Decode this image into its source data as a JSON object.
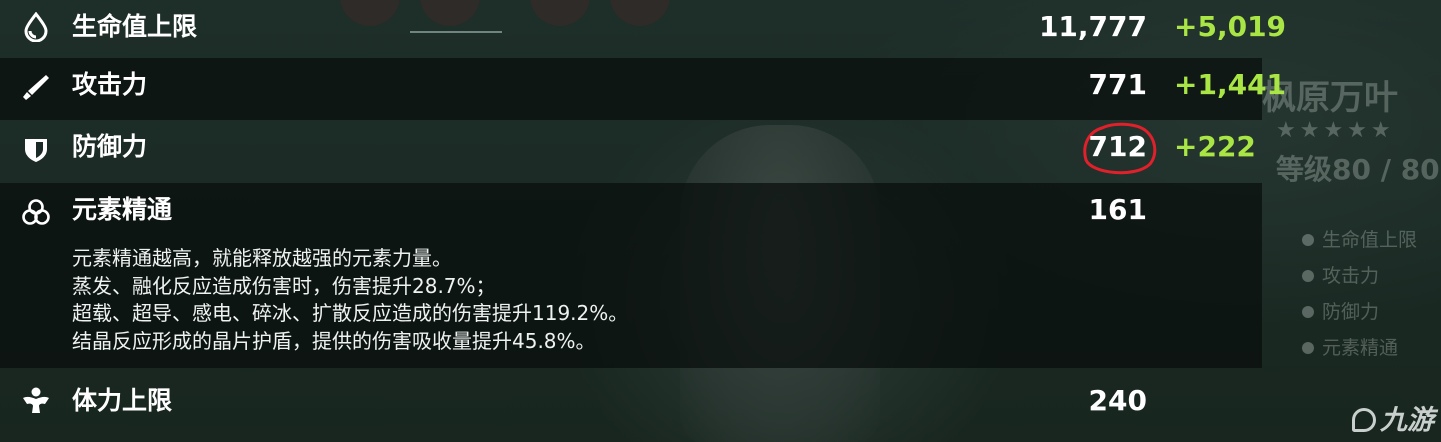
{
  "stats": {
    "hp": {
      "label": "生命值上限",
      "value": "11,777",
      "bonus": "+5,019",
      "icon": "water-drop-icon"
    },
    "atk": {
      "label": "攻击力",
      "value": "771",
      "bonus": "+1,441",
      "icon": "sword-icon"
    },
    "def": {
      "label": "防御力",
      "value": "712",
      "bonus": "+222",
      "icon": "shield-icon"
    },
    "em": {
      "label": "元素精通",
      "value": "161",
      "icon": "elemental-mastery-icon",
      "description": [
        "元素精通越高，就能释放越强的元素力量。",
        "蒸发、融化反应造成伤害时，伤害提升28.7%；",
        "超载、超导、感电、碎冰、扩散反应造成的伤害提升119.2%。",
        "结晶反应形成的晶片护盾，提供的伤害吸收量提升45.8%。"
      ]
    },
    "stamina": {
      "label": "体力上限",
      "value": "240",
      "icon": "stamina-icon"
    }
  },
  "side_panel": {
    "character_name": "枫原万叶",
    "stars": "★★★★★",
    "level": "等级80 / 80",
    "list": [
      "生命值上限",
      "攻击力",
      "防御力",
      "元素精通"
    ]
  },
  "watermark": "九游",
  "colors": {
    "bonus_green": "#a9e545",
    "annotation_red": "#e0202a",
    "text_white": "#ffffff"
  }
}
